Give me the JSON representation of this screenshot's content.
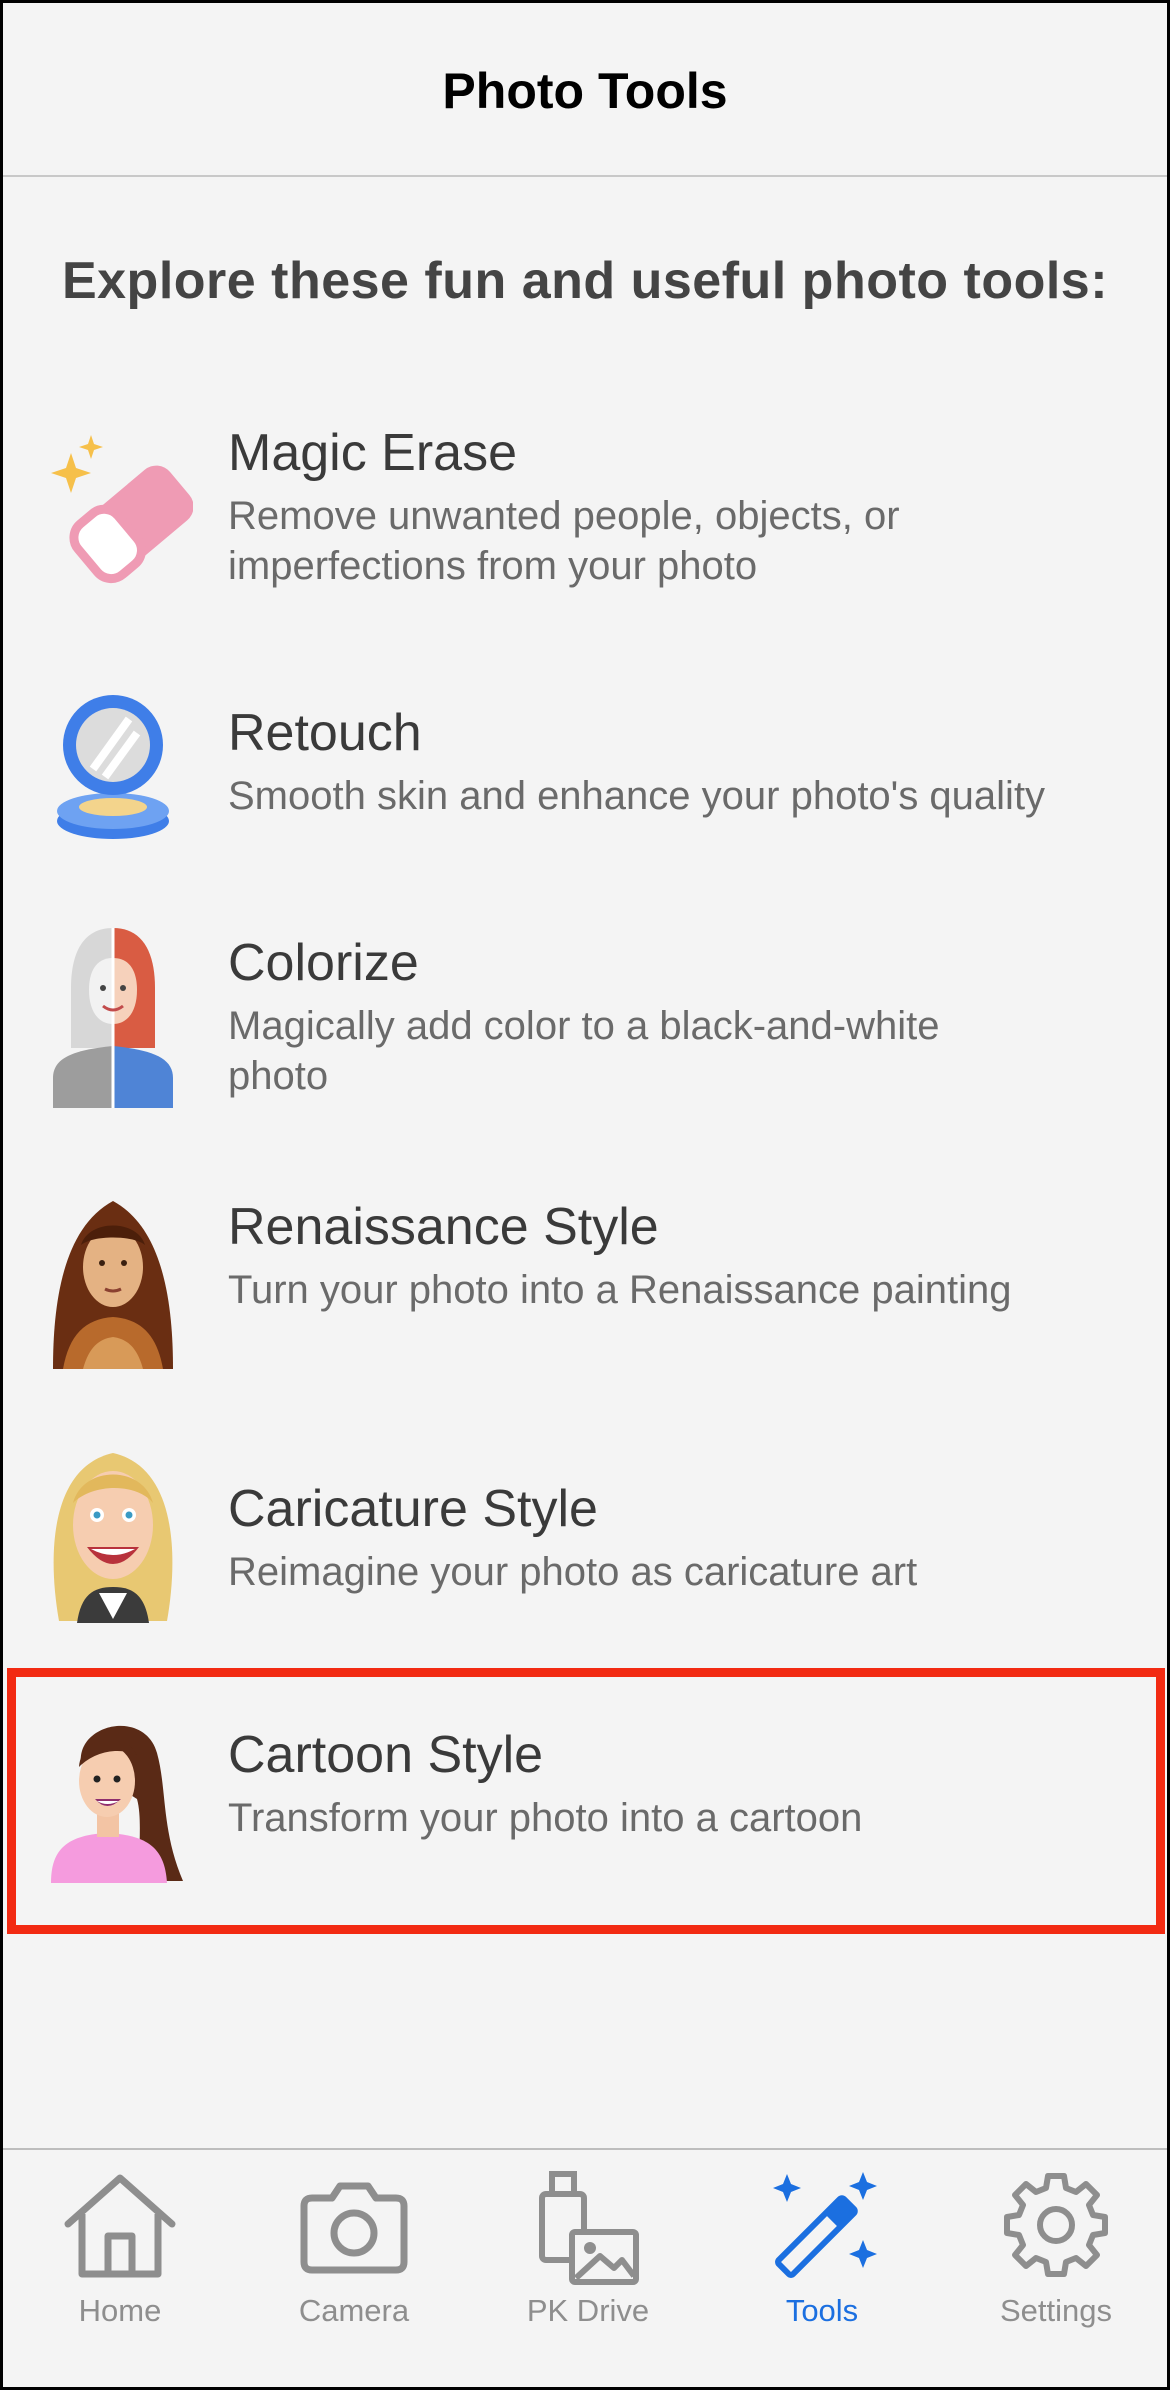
{
  "nav": {
    "title": "Photo Tools"
  },
  "intro": "Explore these fun and useful photo tools:",
  "tools": [
    {
      "name": "Magic Erase",
      "desc": "Remove unwanted people, objects, or imperfections from your photo",
      "icon": "eraser-icon"
    },
    {
      "name": "Retouch",
      "desc": "Smooth skin and enhance your photo's quality",
      "icon": "compact-mirror-icon"
    },
    {
      "name": "Colorize",
      "desc": "Magically add color to a black-and-white photo",
      "icon": "colorize-portrait-icon"
    },
    {
      "name": "Renaissance Style",
      "desc": "Turn your photo into a Renaissance painting",
      "icon": "renaissance-portrait-icon"
    },
    {
      "name": "Caricature Style",
      "desc": "Reimagine your photo as caricature art",
      "icon": "caricature-portrait-icon"
    },
    {
      "name": "Cartoon Style",
      "desc": "Transform your photo into a cartoon",
      "icon": "cartoon-portrait-icon"
    }
  ],
  "tabs": [
    {
      "label": "Home",
      "icon": "home-icon",
      "active": false
    },
    {
      "label": "Camera",
      "icon": "camera-icon",
      "active": false
    },
    {
      "label": "PK Drive",
      "icon": "drive-icon",
      "active": false
    },
    {
      "label": "Tools",
      "icon": "magic-wand-icon",
      "active": true
    },
    {
      "label": "Settings",
      "icon": "gear-icon",
      "active": false
    }
  ],
  "colors": {
    "accent": "#1b6fe0",
    "highlight": "#f22a12",
    "background": "#f4f4f4",
    "inactive_tab": "#8e8e8e"
  }
}
